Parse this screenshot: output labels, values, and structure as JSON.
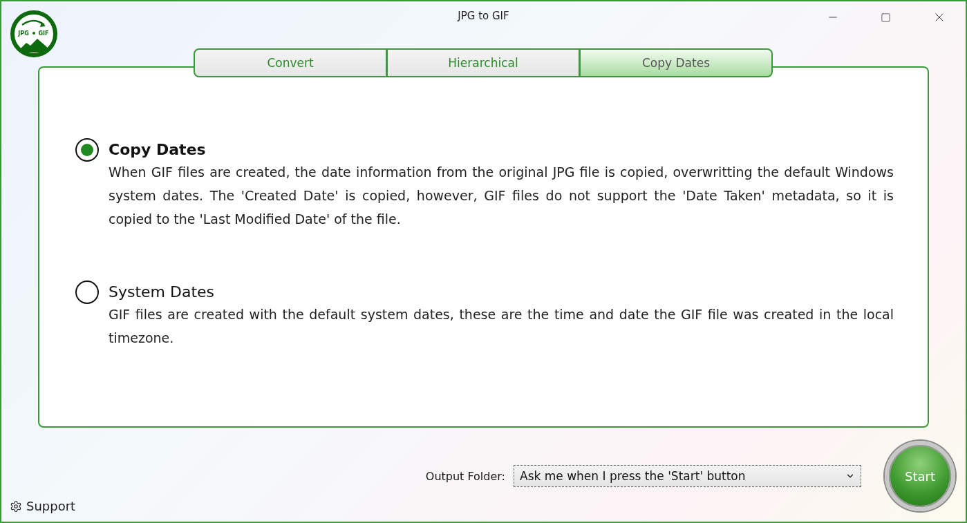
{
  "window": {
    "title": "JPG to GIF",
    "logo": {
      "left_text": "JPG",
      "right_text": "GIF"
    }
  },
  "tabs": [
    {
      "label": "Convert",
      "selected": false
    },
    {
      "label": "Hierarchical",
      "selected": false
    },
    {
      "label": "Copy Dates",
      "selected": true
    }
  ],
  "options": [
    {
      "title": "Copy Dates",
      "description": "When GIF files are created, the date information from the original JPG file is copied, overwritting the default Windows system dates. The 'Created Date' is copied, however, GIF files do not support the 'Date Taken' metadata, so it is copied to the 'Last Modified Date' of the file.",
      "selected": true
    },
    {
      "title": "System Dates",
      "description": "GIF files are created with the default system dates, these are the time and date the GIF file was created in the local timezone.",
      "selected": false
    }
  ],
  "output_folder": {
    "label": "Output Folder:",
    "value": "Ask me when I press the 'Start' button"
  },
  "start_button": "Start",
  "support_link": "Support"
}
